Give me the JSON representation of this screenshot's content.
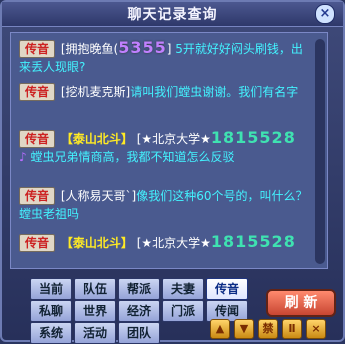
{
  "window": {
    "title": "聊天记录查询"
  },
  "messages": [
    {
      "tag": "传音",
      "sender": "[拥抱晚鱼(",
      "number": "5355",
      "sender_end": "]",
      "text": "5开就好好闷头刷钱，出来丢人现眼?"
    },
    {
      "tag": "传音",
      "sender": "[挖机麦克斯]",
      "text": "请叫我们螳虫谢谢。我们有名字"
    },
    {
      "tag": "传音",
      "faction": "【泰山北斗】",
      "sender": "[★北京大学★",
      "number": "1815528",
      "text": "螳虫兄弟情商高，我都不知道怎么反驳"
    },
    {
      "tag": "传音",
      "sender": "[人称易天哥`]",
      "text": "像我们这种60个号的，叫什么？螳虫老祖吗"
    },
    {
      "tag": "传音",
      "faction": "【泰山北斗】",
      "sender": "[★北京大学★",
      "number": "1815528"
    }
  ],
  "tabs": [
    [
      "当前",
      "队伍",
      "帮派",
      "夫妻",
      "传音"
    ],
    [
      "私聊",
      "世界",
      "经济",
      "门派",
      "传闻"
    ],
    [
      "系统",
      "活动",
      "团队"
    ]
  ],
  "active_tab": "传音",
  "refresh_label": "刷 新",
  "bottom_controls": [
    "up-arrow-icon",
    "down-arrow-icon",
    "forbid-icon",
    "pause-icon",
    "close-icon"
  ],
  "colors": {
    "accent": "#43f3ff",
    "faction": "#ffea24",
    "tag": "#c22"
  }
}
